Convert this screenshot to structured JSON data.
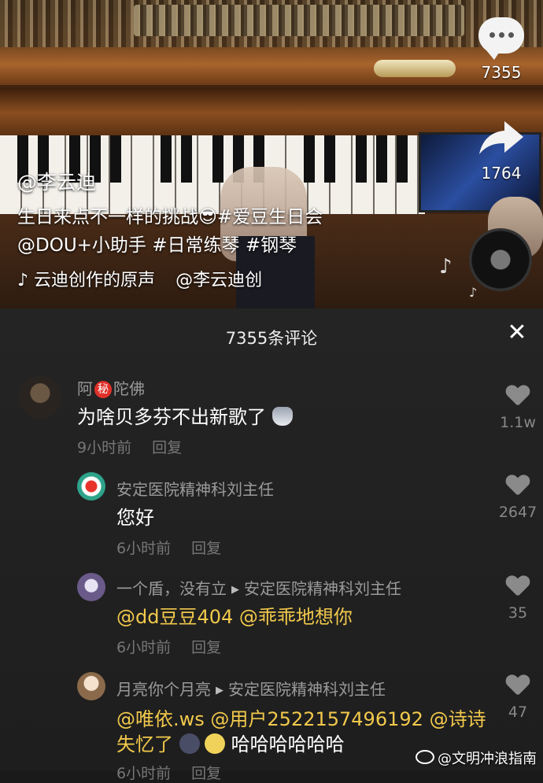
{
  "video": {
    "side": {
      "comment_count": "7355",
      "share_count": "1764"
    },
    "author": "@李云迪",
    "caption_line1": "生日来点不一样的挑战😎#爱豆生日会",
    "caption_line2": "@DOU+小助手 #日常练琴 #钢琴",
    "music_note_icon": "♪",
    "music_title": "云迪创作的原声",
    "music_author": "@李云迪创"
  },
  "comments_panel": {
    "title": "7355条评论",
    "close_label": "✕",
    "comments": [
      {
        "name_part1": "阿",
        "badge": "秘",
        "name_part2": "陀佛",
        "text": "为啥贝多芬不出新歌了",
        "time": "9小时前",
        "reply_label": "回复",
        "likes": "1.1w"
      },
      {
        "name": "安定医院精神科刘主任",
        "text": "您好",
        "time": "6小时前",
        "reply_label": "回复",
        "likes": "2647"
      },
      {
        "name": "一个盾，没有立",
        "reply_to": "安定医院精神科刘主任",
        "mention1": "@dd豆豆404",
        "mention2": "@乖乖地想你",
        "time": "6小时前",
        "reply_label": "回复",
        "likes": "35"
      },
      {
        "name": "月亮你个月亮",
        "reply_to": "安定医院精神科刘主任",
        "mention1": "@唯依.ws",
        "mention2": "@用户2522157496192",
        "mention3": "@诗诗",
        "line2_mention": "失忆了",
        "line2_text": "哈哈哈哈哈哈",
        "time": "6小时前",
        "reply_label": "回复",
        "likes": "47"
      }
    ]
  },
  "watermark": "@文明冲浪指南"
}
